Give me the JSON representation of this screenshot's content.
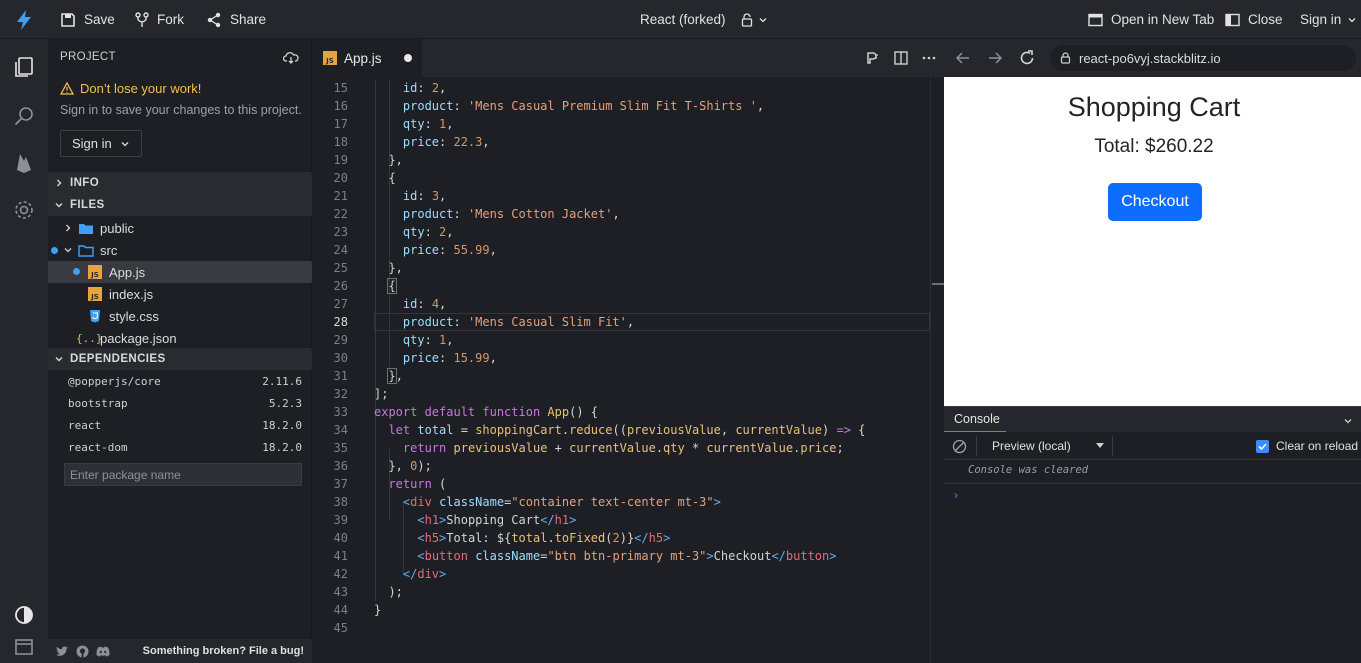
{
  "topbar": {
    "save": "Save",
    "fork": "Fork",
    "share": "Share",
    "project_title": "React (forked)",
    "open_new_tab": "Open in New Tab",
    "close": "Close",
    "sign_in": "Sign in",
    "logo": "bolt-icon"
  },
  "sidebar": {
    "header": "PROJECT",
    "warning_title": "Don’t lose your work!",
    "warning_sub": "Sign in to save your changes to this project.",
    "sign_in": "Sign in",
    "sections": {
      "info": "INFO",
      "files": "FILES",
      "dependencies": "DEPENDENCIES"
    },
    "files": [
      {
        "name": "public",
        "type": "folder"
      },
      {
        "name": "src",
        "type": "folder"
      },
      {
        "name": "App.js",
        "type": "js",
        "active": true
      },
      {
        "name": "index.js",
        "type": "js"
      },
      {
        "name": "style.css",
        "type": "css"
      },
      {
        "name": "package.json",
        "type": "json"
      }
    ],
    "dependencies": [
      {
        "name": "@popperjs/core",
        "version": "2.11.6"
      },
      {
        "name": "bootstrap",
        "version": "5.2.3"
      },
      {
        "name": "react",
        "version": "18.2.0"
      },
      {
        "name": "react-dom",
        "version": "18.2.0"
      }
    ],
    "dep_placeholder": "Enter package name",
    "footer_bug": "Something broken? File a bug!"
  },
  "editor": {
    "tab": "App.js",
    "line_numbers": [
      "15",
      "16",
      "17",
      "18",
      "19",
      "20",
      "21",
      "22",
      "23",
      "24",
      "25",
      "26",
      "27",
      "28",
      "29",
      "30",
      "31",
      "32",
      "33",
      "34",
      "35",
      "36",
      "37",
      "38",
      "39",
      "40",
      "41",
      "42",
      "43",
      "44",
      "45"
    ],
    "current_line": "28"
  },
  "preview": {
    "url": "react-po6vyj.stackblitz.io",
    "heading": "Shopping Cart",
    "total": "Total: $260.22",
    "checkout": "Checkout",
    "console_tab": "Console",
    "preview_select": "Preview (local)",
    "clear_on_reload": "Clear on reload",
    "console_message": "Console was cleared"
  },
  "colors": {
    "accent": "#3ea1f6",
    "primary_button": "#0d6efd",
    "warning": "#f0c14b"
  }
}
